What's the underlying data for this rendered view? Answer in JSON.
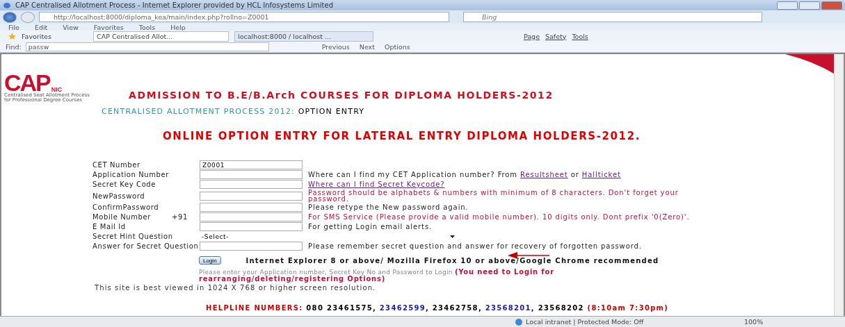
{
  "window": {
    "title": "CAP  Centralised Allotment Process - Internet Explorer provided by HCL Infosystems Limited"
  },
  "address": {
    "url": "http://localhost:8000/diploma_kea/main/index.php?rollno=Z0001"
  },
  "search": {
    "placeholder": "Bing"
  },
  "menu": [
    "File",
    "Edit",
    "View",
    "Favorites",
    "Tools",
    "Help"
  ],
  "favorites": {
    "label": "Favorites"
  },
  "tabs": [
    {
      "label": "CAP  Centralised Allot...",
      "selected": true
    },
    {
      "label": "localhost:8000 / localhost ...",
      "selected": false
    }
  ],
  "commands": [
    "Page",
    "Safety",
    "Tools"
  ],
  "find": {
    "label": "Find:",
    "value": "passw",
    "buttons": [
      "Previous",
      "Next",
      "Options"
    ]
  },
  "page": {
    "logo": {
      "text": "CAP",
      "sub": "NIC",
      "caption": [
        "Centralised Seat Allotment Process",
        "for Professional Degree Courses"
      ]
    },
    "heading": "ADMISSION TO B.E/B.Arch COURSES FOR DIPLOMA HOLDERS-2012",
    "subheading": [
      "CENTRALISED ALLOTMENT PROCESS 2012:",
      "OPTION ENTRY"
    ],
    "title": "ONLINE OPTION ENTRY FOR LATERAL ENTRY DIPLOMA HOLDERS-2012.",
    "form": [
      {
        "kind": "text",
        "label": "CET Number",
        "value": "Z0001"
      },
      {
        "kind": "text",
        "label": "Application Number",
        "hint": [
          {
            "kind": "plain",
            "text": "Where can I find my CET Application number? From "
          },
          {
            "kind": "link",
            "text": "Resultsheet"
          },
          {
            "kind": "plain",
            "text": " or "
          },
          {
            "kind": "link",
            "text": "Hallticket"
          }
        ]
      },
      {
        "kind": "text",
        "label": "Secret Key Code",
        "hint": [
          {
            "kind": "link",
            "text": "Where can I find Secret Keycode?"
          }
        ]
      },
      {
        "kind": "text",
        "label": "NewPassword",
        "hint": [
          {
            "kind": "warning",
            "text": "Password should be alphabets & numbers with minimum of 8 characters. Don't forget your password."
          }
        ]
      },
      {
        "kind": "text",
        "label": "ConfirmPassword",
        "hint": [
          {
            "kind": "plain",
            "text": "Please retype the New password again."
          }
        ]
      },
      {
        "kind": "text",
        "label": "Mobile Number",
        "prefix": "+91",
        "hint": [
          {
            "kind": "warning",
            "text": "For SMS Service (Please provide a valid mobile number). 10 digits only. Dont prefix '0(Zero)'."
          }
        ]
      },
      {
        "kind": "text",
        "label": "E Mail Id",
        "hint": [
          {
            "kind": "plain",
            "text": "For getting Login email alerts."
          }
        ]
      },
      {
        "kind": "select",
        "label": "Secret Hint Question",
        "value": "-Select-"
      },
      {
        "kind": "text",
        "label": "Answer for Secret Question",
        "hint": [
          {
            "kind": "plain",
            "text": "Please remember secret question and answer for recovery of forgotten password."
          }
        ]
      }
    ],
    "login": "Login",
    "browser_note": "Internet Explorer 8 or above/ Mozilla Firefox 10 or above/Google Chrome recommended",
    "login_note": [
      {
        "kind": "plain",
        "text": "Please enter your Application number, Secret Key No and Password to Login "
      },
      {
        "kind": "strong",
        "text": "(You need to Login for rearranging/deleting/registering Options)"
      }
    ],
    "resolution": "This site is best viewed in 1024 X 768 or higher screen resolution.",
    "helpline": [
      {
        "text": "HELPLINE NUMBERS: ",
        "color": "#cc0000"
      },
      {
        "text": "080 23461575, ",
        "color": "#000000"
      },
      {
        "text": "23462599",
        "color": "#1a1aa6"
      },
      {
        "text": ", 23462758, ",
        "color": "#000000"
      },
      {
        "text": "23568201",
        "color": "#1a1aa6"
      },
      {
        "text": ", 23568202 ",
        "color": "#000000"
      },
      {
        "text": "(8:10am 7:30pm)",
        "color": "#cc0000"
      }
    ]
  },
  "status": {
    "zone": "Local intranet | Protected Mode: Off",
    "zoom": "100%"
  }
}
